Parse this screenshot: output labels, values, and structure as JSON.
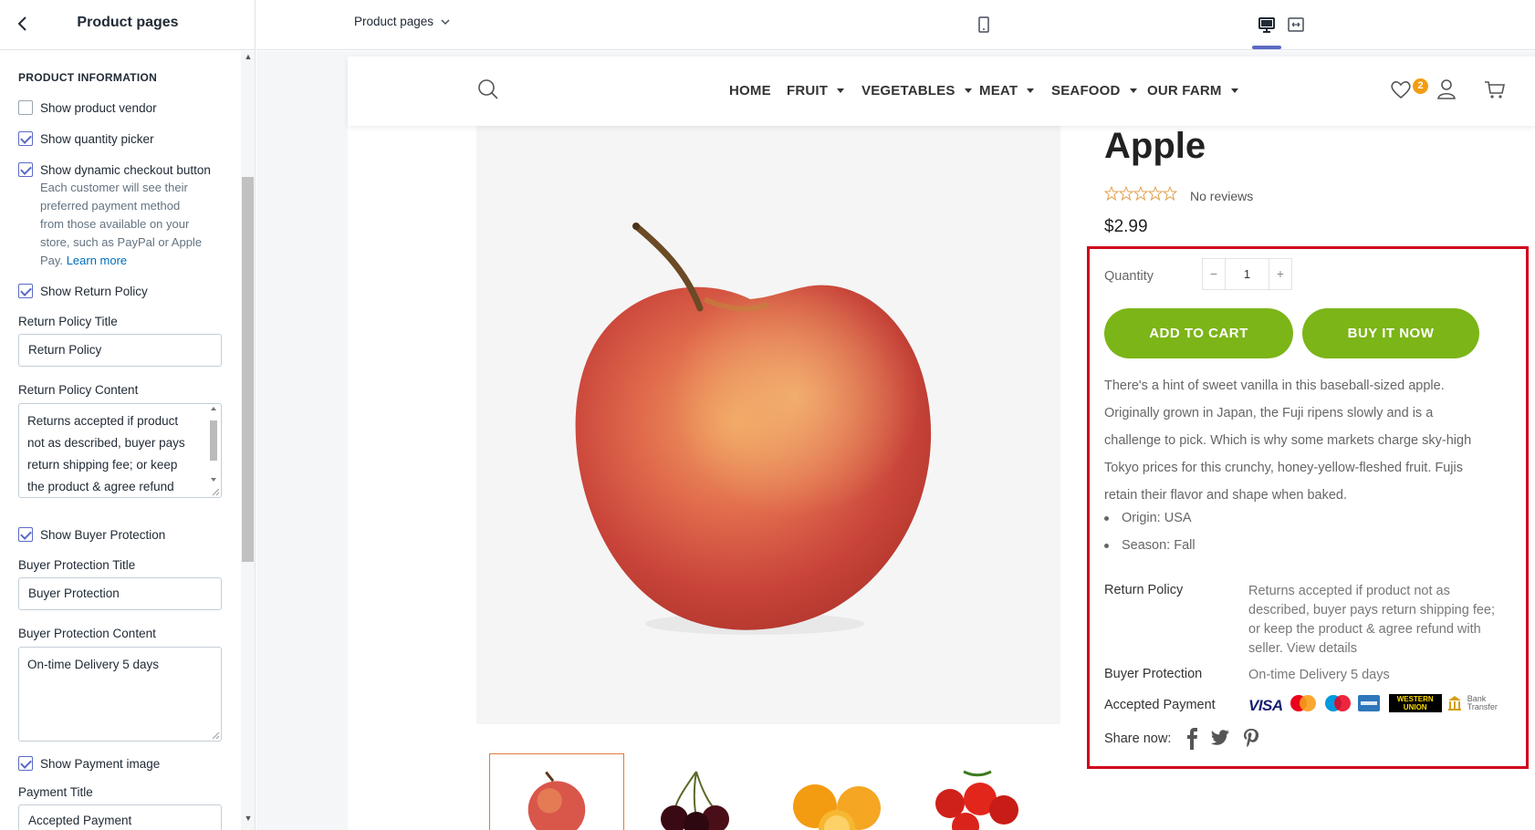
{
  "sidebar": {
    "title": "Product pages",
    "section_heading": "PRODUCT INFORMATION",
    "checkboxes": [
      {
        "label": "Show product vendor",
        "checked": false
      },
      {
        "label": "Show quantity picker",
        "checked": true
      },
      {
        "label": "Show dynamic checkout button",
        "checked": true
      },
      {
        "label": "Show Return Policy",
        "checked": true
      },
      {
        "label": "Show Buyer Protection",
        "checked": true
      },
      {
        "label": "Show Payment image",
        "checked": true
      }
    ],
    "checkout_help_lines": [
      "Each customer will see their",
      "preferred payment method",
      "from those available on your",
      "store, such as PayPal or Apple"
    ],
    "checkout_help_tail": "Pay.",
    "learn_more": "Learn more",
    "return_title_label": "Return Policy Title",
    "return_title_value": "Return Policy",
    "return_content_label": "Return Policy Content",
    "return_content_lines": [
      "Returns accepted if product",
      "not as described, buyer pays",
      "return shipping fee; or keep",
      "the product & agree refund"
    ],
    "buyer_title_label": "Buyer Protection Title",
    "buyer_title_value": "Buyer Protection",
    "buyer_content_label": "Buyer Protection Content",
    "buyer_content_value": "On-time Delivery 5 days",
    "payment_title_label": "Payment Title",
    "payment_title_value": "Accepted Payment"
  },
  "topbar": {
    "page_select": "Product pages",
    "active_device": "desktop"
  },
  "store": {
    "nav": [
      {
        "label": "HOME",
        "dropdown": false
      },
      {
        "label": "FRUIT",
        "dropdown": true
      },
      {
        "label": "VEGETABLES",
        "dropdown": true
      },
      {
        "label": "MEAT",
        "dropdown": true
      },
      {
        "label": "SEAFOOD",
        "dropdown": true
      },
      {
        "label": "OUR FARM",
        "dropdown": true
      }
    ],
    "wishlist_count": "2"
  },
  "product": {
    "title": "Apple",
    "rating": 0,
    "reviews": "No reviews",
    "price": "$2.99",
    "quantity_label": "Quantity",
    "quantity": "1",
    "add_to_cart": "ADD TO CART",
    "buy_now": "BUY IT NOW",
    "description_lines": [
      "There's a hint of sweet vanilla in this baseball-sized apple.",
      "Originally grown in Japan, the Fuji ripens slowly and is a",
      "challenge to pick. Which is why some markets charge sky-high",
      "Tokyo prices for this crunchy, honey-yellow-fleshed fruit. Fujis",
      "retain their flavor and shape when baked."
    ],
    "bullets": [
      "Origin: USA",
      "Season: Fall"
    ],
    "return_policy_label": "Return Policy",
    "return_policy_lines": [
      "Returns accepted if product not as",
      "described, buyer pays return shipping fee;",
      "or keep the product & agree refund with",
      "seller. View details"
    ],
    "buyer_protection_label": "Buyer Protection",
    "buyer_protection_value": "On-time Delivery 5 days",
    "accepted_payment_label": "Accepted Payment",
    "payment_logos": {
      "visa": "VISA",
      "western_union_1": "WESTERN",
      "western_union_2": "UNION",
      "bank_1": "Bank",
      "bank_2": "Transfer"
    },
    "share_label": "Share now:",
    "thumbnails": [
      "apple",
      "cherries",
      "oranges",
      "tomatoes"
    ]
  },
  "colors": {
    "accent_green": "#7cb518",
    "highlight_red": "#d0021b",
    "admin_accent": "#5c6ac4",
    "badge_orange": "#f39c12"
  }
}
